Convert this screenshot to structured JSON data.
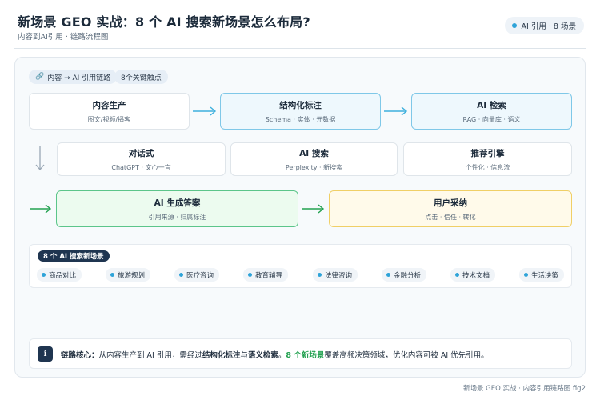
{
  "header": {
    "title": "新场景 GEO 实战：8 个 AI 搜索新场景怎么布局?",
    "subtitle": "内容到AI引用 · 链路流程图",
    "badge": "AI 引用 · 8 场景"
  },
  "chips": {
    "chain": "内容 → AI 引用链路",
    "touchpoints": "8个关键触点"
  },
  "nodes": {
    "content_production": {
      "title": "内容生产",
      "sub": "图文/视频/播客"
    },
    "structured_markup": {
      "title": "结构化标注",
      "sub": "Schema · 实体 · 元数据"
    },
    "ai_retrieval": {
      "title": "AI 检索",
      "sub": "RAG · 向量库 · 语义"
    },
    "conversational": {
      "title": "对话式",
      "sub": "ChatGPT · 文心一言"
    },
    "ai_search": {
      "title": "AI 搜索",
      "sub": "Perplexity · 新搜索"
    },
    "recommendation_engine": {
      "title": "推荐引擎",
      "sub": "个性化 · 信息流"
    },
    "ai_generated_answer": {
      "title": "AI 生成答案",
      "sub": "引用来源 · 归属标注"
    },
    "user_adoption": {
      "title": "用户采纳",
      "sub": "点击 · 信任 · 转化"
    }
  },
  "scenes": {
    "label": "8 个 AI 搜索新场景",
    "items": [
      "商品对比",
      "旅游规划",
      "医疗咨询",
      "教育辅导",
      "法律咨询",
      "金融分析",
      "技术文档",
      "生活决策"
    ]
  },
  "core": {
    "icon": "i",
    "lead": "链路核心：",
    "part1": "从内容生产到 AI 引用，需经过",
    "bold1": "结构化标注",
    "part2": "与",
    "bold2": "语义检索",
    "part3": "。",
    "green": "8 个新场景",
    "part4": "覆盖高频决策领域，优化内容可被 AI 优先引用。"
  },
  "footer": "新场景 GEO 实战 · 内容引用链路图 fig2",
  "colors": {
    "accent_blue": "#2ea3d8",
    "green": "#23a150",
    "navy": "#1f3550"
  }
}
